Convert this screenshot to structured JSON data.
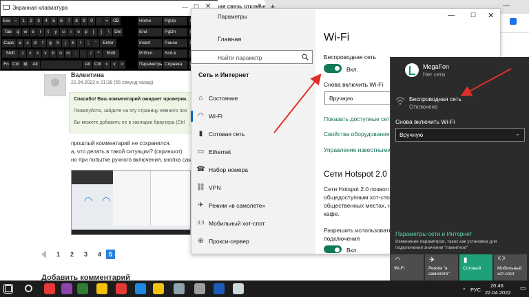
{
  "browser": {
    "tab_title": "Беспроводная связь отключена",
    "new_tab": "+",
    "minimize": "—"
  },
  "comment": {
    "author": "Валентина",
    "date": "22.04.2022 в 21:38 (55 секунд назад)",
    "notice_title": "Спасибо! Ваш комментарий ожидает проверки.",
    "notice_line2": "Пожалуйста, зайдите на эту страницу немного поз",
    "notice_line3": "Вы можете добавить ее в закладки браузера (Ctrl",
    "line1": "прошлый комментарий не сохранился.",
    "line2": "а, что делать в такой ситуации? (скриншот)",
    "line3": "но при попытке ручного включения. кнопка сам"
  },
  "pagination": {
    "pages": [
      "1",
      "2",
      "3",
      "4",
      "5"
    ],
    "active": "5"
  },
  "add_comment": "Добавить комментарий",
  "osk": {
    "title": "Экранная клавиатура",
    "rows": [
      [
        "Esc",
        "~",
        "1",
        "2",
        "3",
        "4",
        "5",
        "6",
        "7",
        "8",
        "9",
        "0",
        "-",
        "=",
        "⌫"
      ],
      [
        "Tab",
        "q",
        "w",
        "e",
        "r",
        "t",
        "y",
        "u",
        "i",
        "o",
        "p",
        "[",
        "]",
        "\\",
        "Del"
      ],
      [
        "Caps",
        "a",
        "s",
        "d",
        "f",
        "g",
        "h",
        "j",
        "k",
        "l",
        ";",
        "'",
        "Enter"
      ],
      [
        "Shift",
        "z",
        "x",
        "c",
        "v",
        "b",
        "n",
        "m",
        ",",
        ".",
        "/",
        "^",
        "Shift"
      ],
      [
        "Fn",
        "Ctrl",
        "⊞",
        "Alt",
        "",
        "Alt",
        "Ctrl",
        "<",
        "v",
        ">"
      ]
    ],
    "side": [
      [
        "Home",
        "PgUp",
        "Перейти"
      ],
      [
        "End",
        "PgDn",
        "Вверх"
      ],
      [
        "Insert",
        "Pause",
        "Вниз"
      ],
      [
        "PrtScn",
        "ScrLk",
        "Закрепить"
      ],
      [
        "Параметры",
        "Справка",
        "Исчезание"
      ]
    ]
  },
  "settings": {
    "window_title": "Параметры",
    "home": "Главная",
    "search_placeholder": "Найти параметр",
    "section": "Сеть и Интернет",
    "nav": [
      {
        "icon": "home-icon",
        "glyph": "⌂",
        "label": "Состояние"
      },
      {
        "icon": "wifi-icon",
        "glyph": "◠",
        "label": "Wi-Fi"
      },
      {
        "icon": "cellular-icon",
        "glyph": "▮",
        "label": "Сотовая сеть"
      },
      {
        "icon": "ethernet-icon",
        "glyph": "▭",
        "label": "Ethernet"
      },
      {
        "icon": "dialup-icon",
        "glyph": "☎",
        "label": "Набор номера"
      },
      {
        "icon": "vpn-icon",
        "glyph": "⛓",
        "label": "VPN"
      },
      {
        "icon": "airplane-icon",
        "glyph": "✈",
        "label": "Режим «в самолете»"
      },
      {
        "icon": "hotspot-icon",
        "glyph": "((·))",
        "label": "Мобильный хот-спот"
      },
      {
        "icon": "proxy-icon",
        "glyph": "⊕",
        "label": "Прокси-сервер"
      }
    ],
    "heading": "Wi-Fi",
    "wireless_label": "Беспроводная сеть",
    "toggle_state": "Вкл.",
    "turn_on_again": "Снова включить Wi-Fi",
    "turn_on_value": "Вручную",
    "link1": "Показать доступные сети",
    "link2": "Свойства оборудования",
    "link3": "Управление известными",
    "hotspot_heading": "Сети Hotspot 2.0",
    "hotspot_p1": "Сети Hotspot 2.0 позвол",
    "hotspot_p2": "общедоступным хот-спо",
    "hotspot_p3": "общественных местах, н",
    "hotspot_p4": "кафе.",
    "allow_1": "Разрешить использовать",
    "allow_2": "подключения",
    "allow_state": "Вкл."
  },
  "flyout": {
    "operator": "MegaFon",
    "operator_status": "Нет сети",
    "wireless_title": "Беспроводная сеть",
    "wireless_status": "Отключено",
    "turn_on_again": "Снова включить Wi-Fi",
    "turn_on_value": "Вручную",
    "settings_link": "Параметры сети и Интернет",
    "settings_desc1": "Изменение параметров, таких как установка для",
    "settings_desc2": "подключения значения \"лимитное\"",
    "tiles": [
      {
        "icon": "wifi-icon",
        "glyph": "◠",
        "label": "Wi-Fi",
        "on": false
      },
      {
        "icon": "airplane-icon",
        "glyph": "✈",
        "label": "Режим \"в самолете\"",
        "on": false
      },
      {
        "icon": "cellular-icon",
        "glyph": "▮",
        "label": "Сотовый",
        "on": true
      },
      {
        "icon": "hotspot-icon",
        "glyph": "((·))",
        "label": "Мобильный хот-спот",
        "on": false
      }
    ],
    "colors": {
      "background": "#2b2b2b",
      "accent": "#1fa07a"
    }
  },
  "taskbar": {
    "icons": [
      {
        "name": "windows-start-icon",
        "color": "#ffffff"
      },
      {
        "name": "search-icon",
        "color": "#dddddd"
      },
      {
        "name": "yandex-icon",
        "color": "#e53935"
      },
      {
        "name": "messenger-icon",
        "color": "#8e44ad"
      },
      {
        "name": "shield-icon",
        "color": "#2e7d32"
      },
      {
        "name": "yandex-browser-icon",
        "color": "#f4c20d"
      },
      {
        "name": "yandex-y-icon",
        "color": "#e53935"
      },
      {
        "name": "edge-icon",
        "color": "#1e88e5"
      },
      {
        "name": "explorer-icon",
        "color": "#f1c40f"
      },
      {
        "name": "store-icon",
        "color": "#90a4ae"
      },
      {
        "name": "settings-icon",
        "color": "#9e9e9e"
      },
      {
        "name": "word-icon",
        "color": "#1e5bb8"
      },
      {
        "name": "keyboard-icon",
        "color": "#cfd8dc"
      }
    ],
    "language": "РУС",
    "time": "20:46",
    "date": "22.04.2022"
  }
}
